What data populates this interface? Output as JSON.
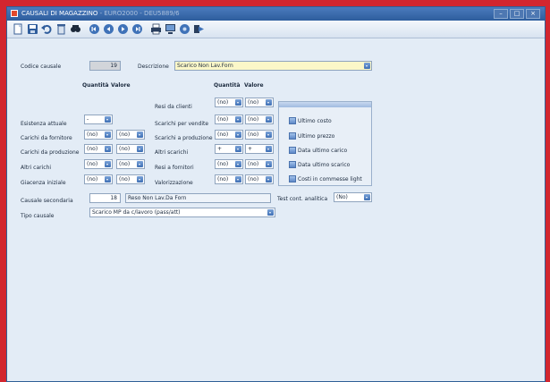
{
  "window": {
    "title": "CAUSALI DI MAGAZZINO",
    "title_extra": "- EURO2000 - DEU5889/6"
  },
  "window_buttons": [
    "–",
    "□",
    "×"
  ],
  "toolbar": {
    "icons": [
      "new-icon",
      "save-icon",
      "undo-icon",
      "delete-icon",
      "search-icon",
      "first-icon",
      "previous-icon",
      "next-icon",
      "last-icon",
      "print-icon",
      "monitor-icon",
      "help-icon",
      "exit-icon"
    ]
  },
  "form": {
    "codice_causale": {
      "label": "Codice causale",
      "value": "19"
    },
    "descrizione": {
      "label": "Descrizione",
      "value": "Scarico Non Lav.Forn"
    },
    "left_headers": {
      "quantita": "Quantità",
      "valore": "Valore"
    },
    "right_headers": {
      "quantita": "Quantità",
      "valore": "Valore"
    },
    "left_rows": [
      {
        "label": "Esistenza attuale",
        "qty": "-",
        "val": null
      },
      {
        "label": "Carichi da fornitore",
        "qty": "(no)",
        "val": "(no)"
      },
      {
        "label": "Carichi da produzione",
        "qty": "(no)",
        "val": "(no)"
      },
      {
        "label": "Altri carichi",
        "qty": "(no)",
        "val": "(no)"
      },
      {
        "label": "Giacenza iniziale",
        "qty": "(no)",
        "val": "(no)"
      }
    ],
    "right_rows": [
      {
        "label": "Resi da clienti",
        "qty": "(no)",
        "val": "(no)"
      },
      {
        "label": "Scarichi per vendite",
        "qty": "(no)",
        "val": "(no)"
      },
      {
        "label": "Scarichi a produzione",
        "qty": "(no)",
        "val": "(no)"
      },
      {
        "label": "Altri scarichi",
        "qty": "+",
        "val": "+"
      },
      {
        "label": "Resi a fornitori",
        "qty": "(no)",
        "val": "(no)"
      },
      {
        "label": "Valorizzazione",
        "qty": "(no)",
        "val": "(no)"
      }
    ],
    "options": [
      "Ultimo costo",
      "Ultimo prezzo",
      "Data ultimo carico",
      "Data ultimo scarico",
      "Costi in commesse light"
    ],
    "causale_secondaria": {
      "label": "Causale secondaria",
      "code": "18",
      "description": "Reso Non Lav.Da Forn"
    },
    "test_cont": {
      "label": "Test cont. analitica",
      "value": "(No)"
    },
    "tipo_causale": {
      "label": "Tipo causale",
      "value": "Scarico MP da c/lavoro (pass/att)"
    }
  }
}
